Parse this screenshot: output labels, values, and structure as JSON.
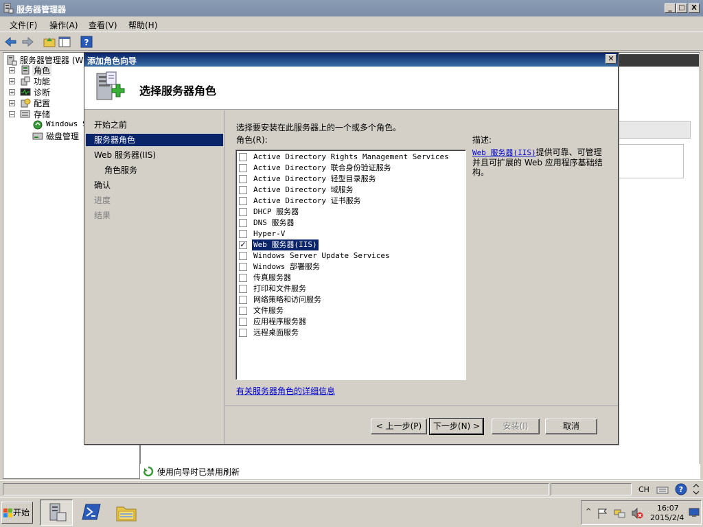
{
  "main_window": {
    "title": "服务器管理器",
    "menu": [
      "文件(F)",
      "操作(A)",
      "查看(V)",
      "帮助(H)"
    ],
    "caption_buttons": [
      "_",
      "□",
      "X"
    ]
  },
  "tree": {
    "root": "服务器管理器 (W",
    "items": [
      {
        "label": "角色",
        "expander": "+",
        "icon": "roles-icon",
        "selected": true
      },
      {
        "label": "功能",
        "expander": "+",
        "icon": "features-icon"
      },
      {
        "label": "诊断",
        "expander": "+",
        "icon": "diagnostics-icon"
      },
      {
        "label": "配置",
        "expander": "+",
        "icon": "configuration-icon"
      },
      {
        "label": "存储",
        "expander": "−",
        "icon": "storage-icon"
      }
    ],
    "storage_children": [
      "Windows S",
      "磁盘管理"
    ]
  },
  "status_row_text": "使用向导时已禁用刷新",
  "statusbar": {
    "lang": "CH"
  },
  "dialog": {
    "title": "添加角色向导",
    "heading": "选择服务器角色",
    "nav": [
      {
        "label": "开始之前",
        "state": "normal"
      },
      {
        "label": "服务器角色",
        "state": "selected"
      },
      {
        "label": "Web 服务器(IIS)",
        "state": "normal"
      },
      {
        "label": "角色服务",
        "state": "sub"
      },
      {
        "label": "确认",
        "state": "normal"
      },
      {
        "label": "进度",
        "state": "disabled"
      },
      {
        "label": "结果",
        "state": "disabled"
      }
    ],
    "instruction": "选择要安装在此服务器上的一个或多个角色。",
    "roles_label": "角色(R):",
    "roles": [
      {
        "label": "Active Directory Rights Management Services",
        "checked": false
      },
      {
        "label": "Active Directory 联合身份验证服务",
        "checked": false
      },
      {
        "label": "Active Directory 轻型目录服务",
        "checked": false
      },
      {
        "label": "Active Directory 域服务",
        "checked": false
      },
      {
        "label": "Active Directory 证书服务",
        "checked": false
      },
      {
        "label": "DHCP 服务器",
        "checked": false
      },
      {
        "label": "DNS 服务器",
        "checked": false
      },
      {
        "label": "Hyper-V",
        "checked": false
      },
      {
        "label": "Web 服务器(IIS)",
        "checked": true,
        "selected": true
      },
      {
        "label": "Windows Server Update Services",
        "checked": false
      },
      {
        "label": "Windows 部署服务",
        "checked": false
      },
      {
        "label": "传真服务器",
        "checked": false
      },
      {
        "label": "打印和文件服务",
        "checked": false
      },
      {
        "label": "网络策略和访问服务",
        "checked": false
      },
      {
        "label": "文件服务",
        "checked": false
      },
      {
        "label": "应用程序服务器",
        "checked": false
      },
      {
        "label": "远程桌面服务",
        "checked": false
      }
    ],
    "more_info_link": "有关服务器角色的详细信息",
    "description_label": "描述:",
    "description_link": "Web 服务器(IIS)",
    "description_text": "提供可靠、可管理并且可扩展的 Web 应用程序基础结构。",
    "buttons": {
      "back": "< 上一步(P)",
      "next": "下一步(N) >",
      "install": "安装(I)",
      "cancel": "取消"
    }
  },
  "taskbar": {
    "start": "开始",
    "tray_lang": "CH",
    "time": "16:07",
    "date": "2015/2/4"
  }
}
